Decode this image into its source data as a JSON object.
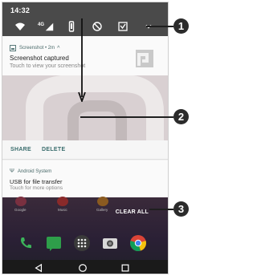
{
  "status_bar": {
    "time": "14:32",
    "network": "4G",
    "icons": [
      "wifi-icon",
      "signal-icon",
      "vibrate-icon",
      "do-not-disturb-icon",
      "screenshot-icon",
      "expand-icon"
    ]
  },
  "screenshot_notification": {
    "app_name": "Screenshot",
    "time_ago": "2m",
    "title": "Screenshot captured",
    "text": "Touch to view your screenshot"
  },
  "actions": {
    "share": "SHARE",
    "delete": "DELETE"
  },
  "usb_notification": {
    "app_name": "Android System",
    "title": "USB for file transfer",
    "text": "Touch for more options"
  },
  "home": {
    "app_labels": [
      "Google",
      "Music",
      "Gallery"
    ],
    "clear_all": "CLEAR ALL"
  },
  "callouts": [
    "1",
    "2",
    "3"
  ],
  "colors": {
    "status_bar": "#4a4a4a",
    "accent": "#3a6d6d",
    "callout": "#2b2b2b"
  }
}
